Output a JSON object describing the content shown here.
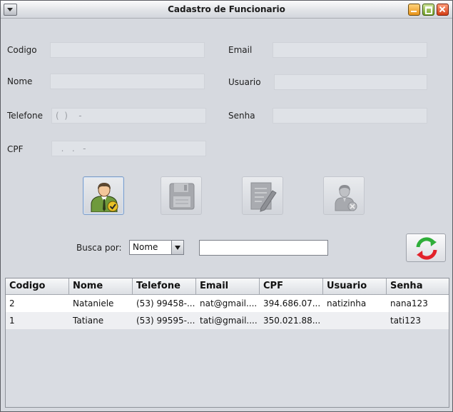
{
  "window": {
    "title": "Cadastro de Funcionario"
  },
  "form": {
    "codigo_label": "Codigo",
    "nome_label": "Nome",
    "telefone_label": "Telefone",
    "telefone_mask": "(  )    -",
    "cpf_label": "CPF",
    "cpf_mask": "  .   .   -",
    "email_label": "Email",
    "usuario_label": "Usuario",
    "senha_label": "Senha"
  },
  "search": {
    "label": "Busca por:",
    "selected": "Nome",
    "value": ""
  },
  "icons": {
    "new": "add-employee-icon",
    "save": "save-floppy-icon",
    "edit": "edit-document-icon",
    "delete": "remove-employee-icon",
    "refresh": "refresh-arrows-icon"
  },
  "table": {
    "columns": [
      "Codigo",
      "Nome",
      "Telefone",
      "Email",
      "CPF",
      "Usuario",
      "Senha"
    ],
    "rows": [
      [
        "2",
        "Nataniele",
        "(53) 99458-...",
        "nat@gmail....",
        "394.686.07...",
        "natizinha",
        "nana123"
      ],
      [
        "1",
        "Tatiane",
        "(53) 99595-...",
        "tati@gmail....",
        "350.021.88...",
        "",
        "tati123"
      ]
    ]
  }
}
